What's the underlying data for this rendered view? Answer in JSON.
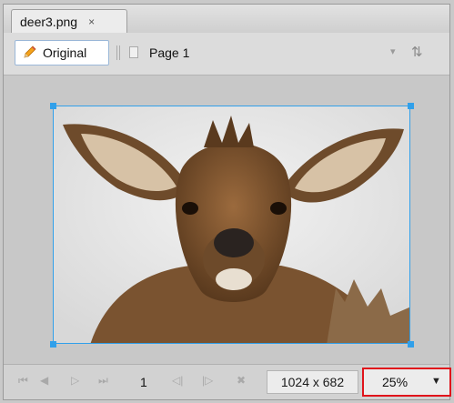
{
  "tab": {
    "title": "deer3.png",
    "close_glyph": "×"
  },
  "toolbar": {
    "original_label": "Original",
    "page_label": "Page 1",
    "dropdown_icon": "chevron-down-icon",
    "sort_icon": "sort-icon"
  },
  "canvas": {
    "image_subject": "deer",
    "selection_color": "#31a0ea"
  },
  "statusbar": {
    "page_number": "1",
    "dimensions": "1024 x 682",
    "zoom": "25%",
    "zoom_highlight_color": "#e0141b"
  }
}
